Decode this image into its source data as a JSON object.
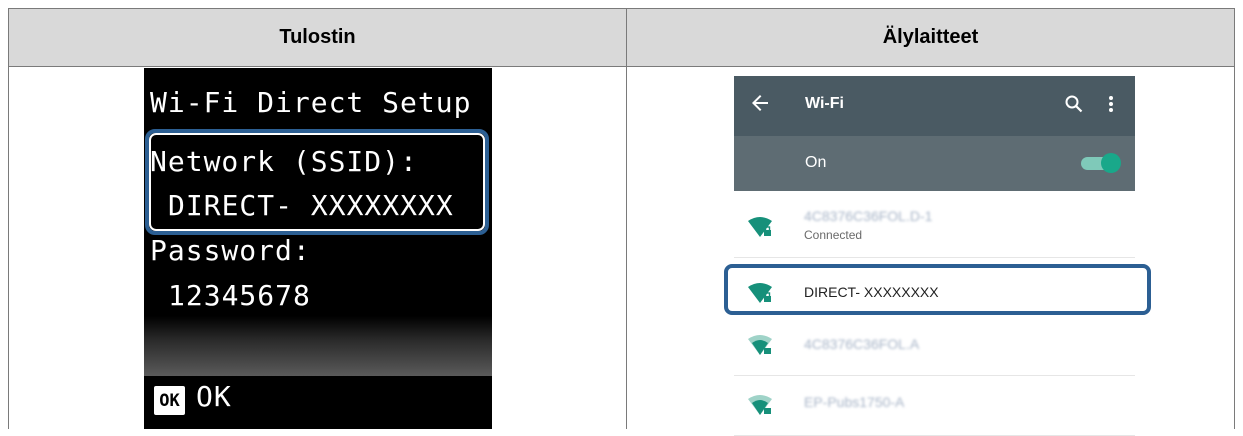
{
  "table": {
    "header_left": "Tulostin",
    "header_right": "Älylaitteet"
  },
  "printer_lcd": {
    "title": "Wi-Fi Direct Setup",
    "network_label": "Network (SSID):",
    "network_value": "DIRECT- XXXXXXXX",
    "password_label": "Password:",
    "password_value": "12345678",
    "ok_key": "OK",
    "ok_label": "OK"
  },
  "phone": {
    "title": "Wi-Fi",
    "toggle_label": "On",
    "toggle_on": true,
    "accent_color": "#19a88a",
    "icons": [
      "back-arrow-icon",
      "search-icon",
      "more-vert-icon",
      "wifi-lock-icon"
    ],
    "networks": [
      {
        "name": "4C8376C36FOL.D-1",
        "status": "Connected",
        "blurred": true,
        "signal": "strong"
      },
      {
        "name": "DIRECT- XXXXXXXX",
        "status": "",
        "blurred": false,
        "signal": "strong",
        "highlighted": true
      },
      {
        "name": "4C8376C36FOL.A",
        "status": "",
        "blurred": true,
        "signal": "medium"
      },
      {
        "name": "EP-Pubs1750-A",
        "status": "",
        "blurred": true,
        "signal": "medium"
      }
    ]
  },
  "highlight_color": "#2c5f93"
}
